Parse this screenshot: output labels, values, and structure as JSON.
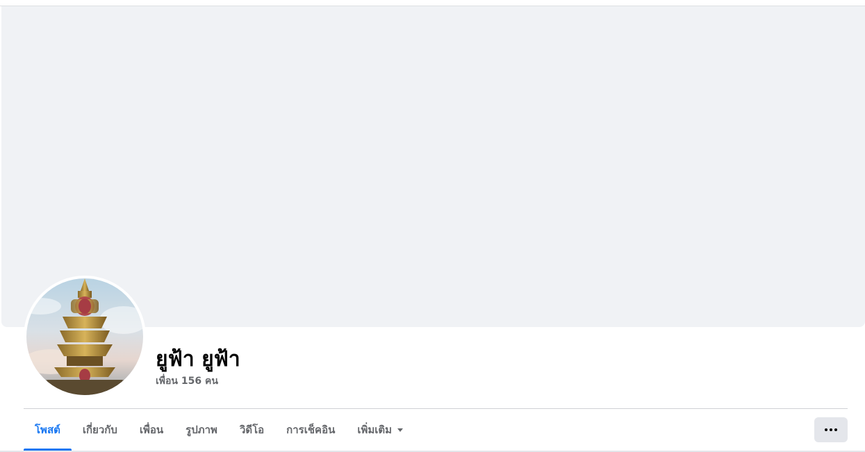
{
  "profile": {
    "name": "ยูฟ้า ยูฟ้า",
    "friends_text": "เพื่อน 156 คน",
    "avatar_icon": "temple-spire-avatar"
  },
  "tabs": [
    {
      "label": "โพสต์",
      "active": true
    },
    {
      "label": "เกี่ยวกับ",
      "active": false
    },
    {
      "label": "เพื่อน",
      "active": false
    },
    {
      "label": "รูปภาพ",
      "active": false
    },
    {
      "label": "วิดีโอ",
      "active": false
    },
    {
      "label": "การเช็คอิน",
      "active": false
    },
    {
      "label": "เพิ่มเติม",
      "active": false
    }
  ],
  "more_menu_icon": "ellipsis-icon",
  "colors": {
    "accent": "#1877f2",
    "cover_bg": "#f0f2f5",
    "secondary_text": "#65676b",
    "button_bg": "#e4e6eb"
  }
}
